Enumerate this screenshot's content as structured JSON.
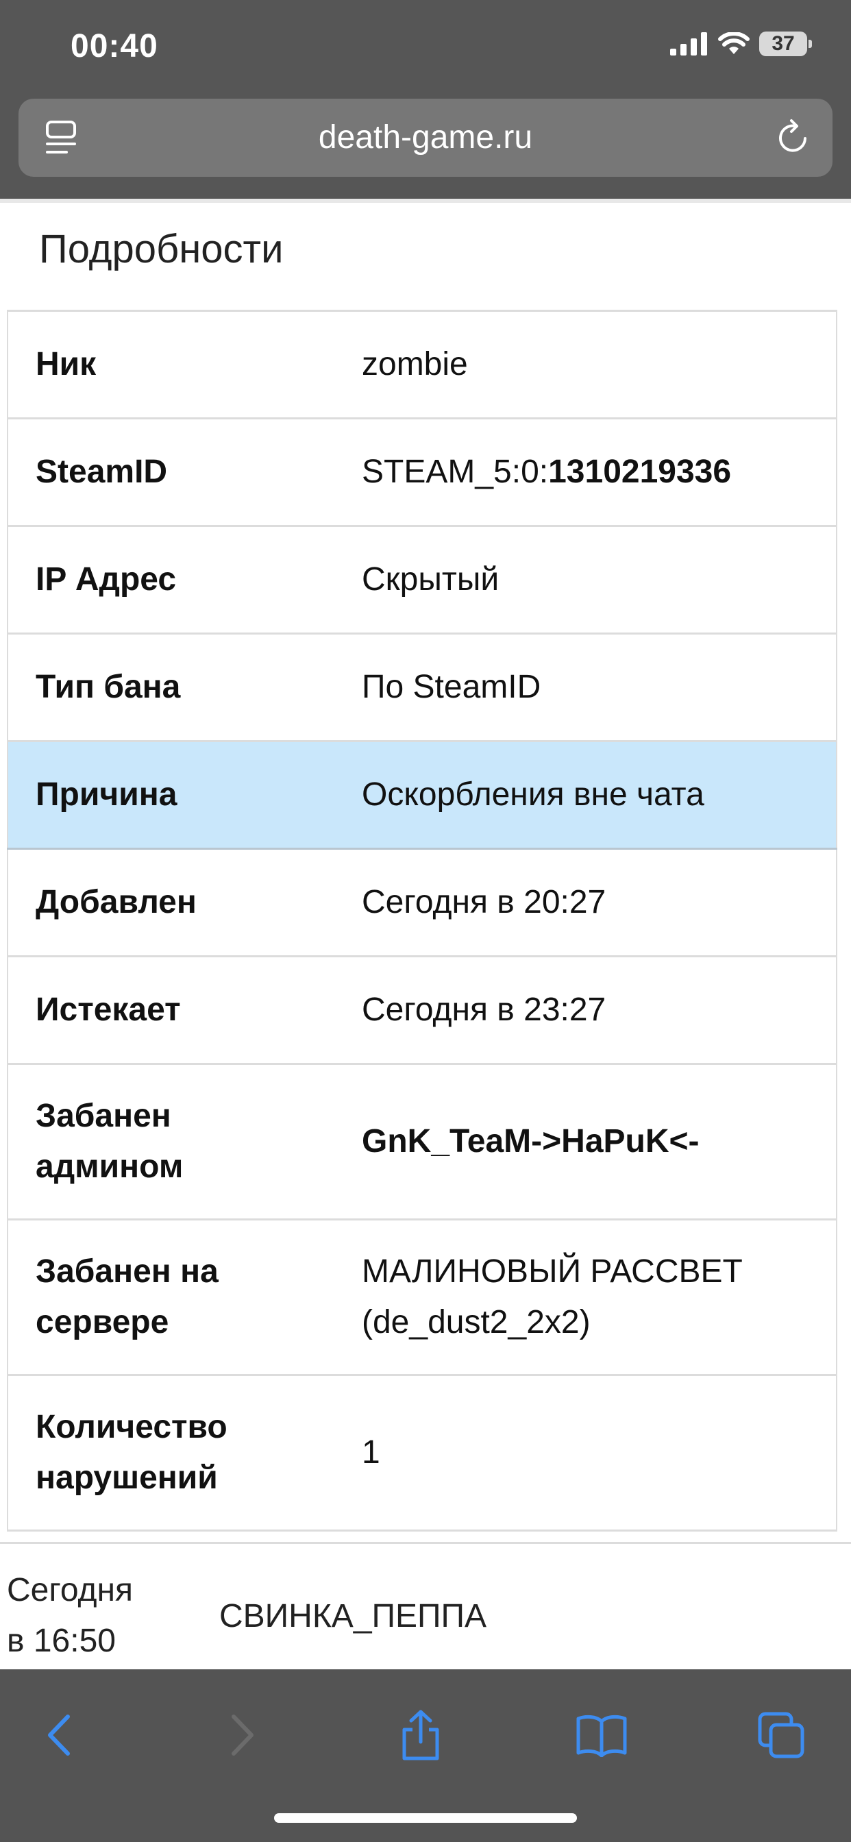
{
  "status_bar": {
    "time": "00:40",
    "battery": "37"
  },
  "browser": {
    "url": "death-game.ru"
  },
  "details": {
    "title": "Подробности",
    "rows": [
      {
        "label": "Ник",
        "value": "zombie"
      },
      {
        "label": "SteamID",
        "value_prefix": "STEAM_5:0:",
        "value_bold": "1310219336"
      },
      {
        "label": "IP Адрес",
        "value": "Скрытый"
      },
      {
        "label": "Тип бана",
        "value": "По SteamID"
      },
      {
        "label": "Причина",
        "value": "Оскорбления вне чата"
      },
      {
        "label": "Добавлен",
        "value": "Сегодня в 20:27"
      },
      {
        "label": "Истекает",
        "value": "Сегодня в 23:27"
      },
      {
        "label_line1": "Забанен",
        "label_line2": "админом",
        "value": "GnK_TeaM->HaPuK<-"
      },
      {
        "label_line1": "Забанен на",
        "label_line2": "сервере",
        "value_line1": "МАЛИНОВЫЙ РАССВЕТ",
        "value_line2": "(de_dust2_2x2)"
      },
      {
        "label_line1": "Количество",
        "label_line2": "нарушений",
        "value": "1"
      }
    ]
  },
  "history_row": {
    "date_line1": "Сегодня",
    "date_line2": "в 16:50",
    "name": "СВИНКА_ПЕППА"
  },
  "colors": {
    "chrome": "#565656",
    "highlight_row": "#c9e7fb",
    "toolbar_icon": "#3d8cf0"
  }
}
